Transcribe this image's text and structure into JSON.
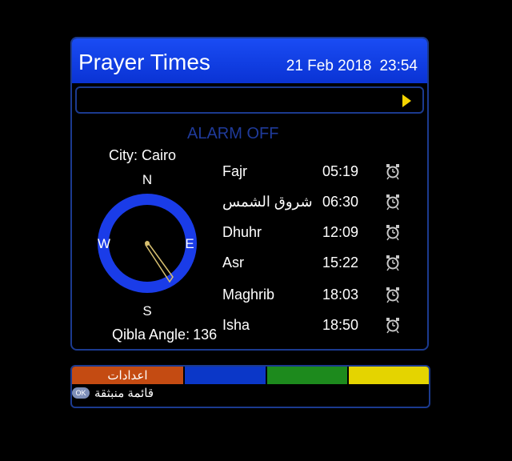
{
  "header": {
    "title": "Prayer Times",
    "date": "21 Feb 2018",
    "time": "23:54"
  },
  "alarm_status": "ALARM OFF",
  "city": {
    "label": "City:",
    "name": "Cairo"
  },
  "compass": {
    "north": "N",
    "south": "S",
    "east": "E",
    "west": "W",
    "qibla_label": "Qibla Angle:",
    "qibla_angle": "136",
    "ring_color": "#1a3ce8"
  },
  "prayers": [
    {
      "name": "Fajr",
      "time": "05:19",
      "icon": "alarm-clock-icon"
    },
    {
      "name": "شروق الشمس",
      "time": "06:30",
      "icon": "alarm-clock-icon"
    },
    {
      "name": "Dhuhr",
      "time": "12:09",
      "icon": "alarm-clock-icon"
    },
    {
      "name": "Asr",
      "time": "15:22",
      "icon": "alarm-clock-icon"
    },
    {
      "name": "Maghrib",
      "time": "18:03",
      "icon": "alarm-clock-icon"
    },
    {
      "name": "Isha",
      "time": "18:50",
      "icon": "alarm-clock-icon"
    }
  ],
  "footer": {
    "red_key_label": "اعدادات",
    "ok_key": "OK",
    "ok_label": "قائمة منبثقة"
  },
  "colors": {
    "title_bar": "#0a33d4",
    "red_key": "#c44b12",
    "blue_key": "#0b37c8",
    "green_key": "#1d8a1d",
    "yellow_key": "#e4d400",
    "alarm_text": "#1f3a9a"
  }
}
